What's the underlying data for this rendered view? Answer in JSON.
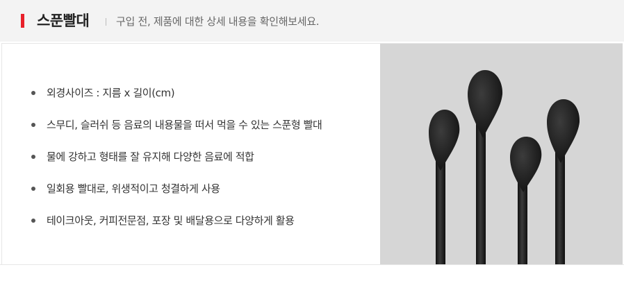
{
  "header": {
    "title": "스푼빨대",
    "subtitle": "구입 전, 제품에 대한 상세 내용을 확인해보세요.",
    "accent_color": "#e8202a"
  },
  "features": [
    "외경사이즈 : 지름 x 길이(cm)",
    "스무디, 슬러쉬 등 음료의 내용물을 떠서 먹을 수 있는 스푼형 빨대",
    "물에 강하고 형태를 잘 유지해 다양한 음료에 적합",
    "일회용 빨대로, 위생적이고 청결하게 사용",
    "테이크아웃, 커피전문점, 포장 및 배달용으로 다양하게 활용"
  ],
  "product_image": {
    "subject": "black spoon straws",
    "straw_color": "#1e1e1e",
    "background_color": "#d6d6d6"
  }
}
